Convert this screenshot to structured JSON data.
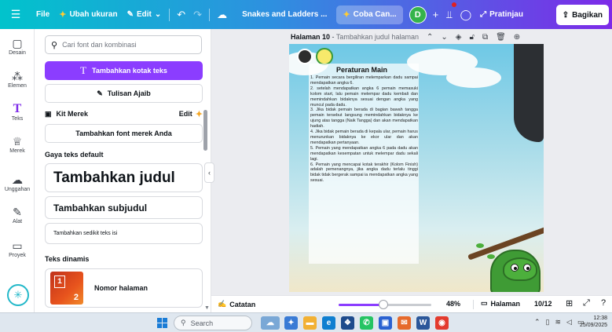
{
  "topbar": {
    "file": "File",
    "resize": "Ubah ukuran",
    "edit": "Edit",
    "doc_title": "Snakes and Ladders ...",
    "try_canva": "Coba Can...",
    "avatar_initial": "D",
    "preview": "Pratinjau",
    "share": "Bagikan"
  },
  "rail": {
    "items": [
      {
        "label": "Desain",
        "icon": "▢"
      },
      {
        "label": "Elemen",
        "icon": "⁂"
      },
      {
        "label": "Teks",
        "icon": "T"
      },
      {
        "label": "Merek",
        "icon": "♕"
      },
      {
        "label": "Unggahan",
        "icon": "☁"
      },
      {
        "label": "Alat",
        "icon": "✎"
      },
      {
        "label": "Proyek",
        "icon": "▭"
      }
    ]
  },
  "panel": {
    "search_placeholder": "Cari font dan kombinasi",
    "add_textbox": "Tambahkan kotak teks",
    "magic_write": "Tulisan Ajaib",
    "brand_kit": "Kit Merek",
    "brand_kit_edit": "Edit",
    "add_brand_font": "Tambahkan font merek Anda",
    "default_styles": "Gaya teks default",
    "add_title": "Tambahkan judul",
    "add_subtitle": "Tambahkan subjudul",
    "add_body": "Tambahkan sedikit teks isi",
    "dynamic_text": "Teks dinamis",
    "page_number": "Nomor halaman"
  },
  "page_header": {
    "page": "Halaman 10",
    "add_title": "Tambahkan judul halaman"
  },
  "page": {
    "title": "Peraturan Main",
    "rules": [
      "1. Pemain secara bergiliran melemparkan dadu sampai mendapatkan angka 6.",
      "2. setelah mendapatkan angka 6 pemain memasuki kolom start, lalu pemain melempar dadu kembali dan memindahkan bidaknya sesuai dengan angka yang muncul pada dadu.",
      "3. Jika bidak pemain berada di bagian bawah tangga pemain tersebut langsung memindahkan bidaknya ke ujung atas tangga (Naik Tangga) dan akan mendapatkan hadiah.",
      "4. Jika bidak pemain berada di kepala ular, pemain harus menurunkan bidaknya ke ekor ular dan akan mendapatkan pertanyaan.",
      "5. Pemain yang mendapatkan angka 6 pada dadu akan mendapatkan kesempatan untuk melempar dadu sekali lagi.",
      "6. Pemain yang mencapai kotak terakhir (Kolom Finish) adalah pemenangnya, jika angka dadu terlalu tinggi bidak tidak bergerak sampai ia mendapatkan angka yang sesuai."
    ]
  },
  "statusbar": {
    "notes": "Catatan",
    "zoom": "48%",
    "zoom_level": 0.48,
    "pages": "Halaman",
    "page_count": "10/12"
  },
  "taskbar": {
    "search": "Search",
    "time": "12:38",
    "date": "25/09/2025"
  },
  "colors": {
    "accent": "#8b3dff",
    "gradient_start": "#01c3cc",
    "gradient_end": "#7d2ae8"
  }
}
